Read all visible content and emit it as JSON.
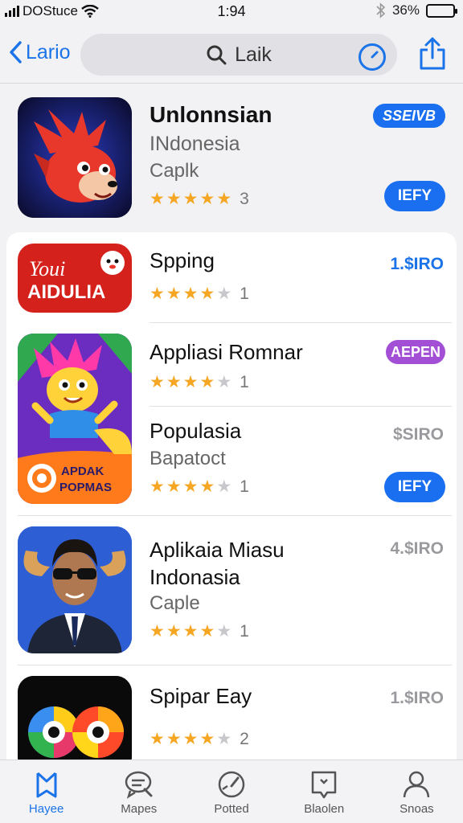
{
  "status_bar": {
    "carrier": "DOStuce",
    "time": "1:94",
    "battery": "36%"
  },
  "nav": {
    "back_label": "Lario",
    "search_text": "Laik"
  },
  "featured": {
    "name": "Unlonnsian",
    "subtitle": "INdonesia",
    "category": "Caplk",
    "rating_count": "3",
    "badge": "SSEIVB",
    "button": "IEFY"
  },
  "apps": [
    {
      "name": "Spping",
      "rating_count": "1",
      "price": "1.$IRO",
      "icon_text": "Youi AIDULIA"
    },
    {
      "name": "Appliasi Romnar",
      "rating_count": "1",
      "badge": "AEPEN"
    },
    {
      "name": "Populasia",
      "subtitle": "Bapatoct",
      "rating_count": "1",
      "price": "$SIRO",
      "button": "IEFY",
      "icon_text": "APDAK POPMAS"
    },
    {
      "name": "Aplikaia Miasu",
      "name_line2": "Indonasia",
      "subtitle": "Caple",
      "rating_count": "1",
      "price": "4.$IRO"
    },
    {
      "name": "Spipar Eay",
      "rating_count": "2",
      "price": "1.$IRO"
    }
  ],
  "tabs": [
    {
      "label": "Hayee",
      "icon": "home-icon"
    },
    {
      "label": "Mapes",
      "icon": "chat-search-icon"
    },
    {
      "label": "Potted",
      "icon": "speed-icon"
    },
    {
      "label": "Blaolen",
      "icon": "bookmark-icon"
    },
    {
      "label": "Snoas",
      "icon": "person-icon"
    }
  ],
  "colors": {
    "accent": "#1a73e8",
    "star": "#f5a623",
    "badge_purple": "#a24fd6"
  }
}
